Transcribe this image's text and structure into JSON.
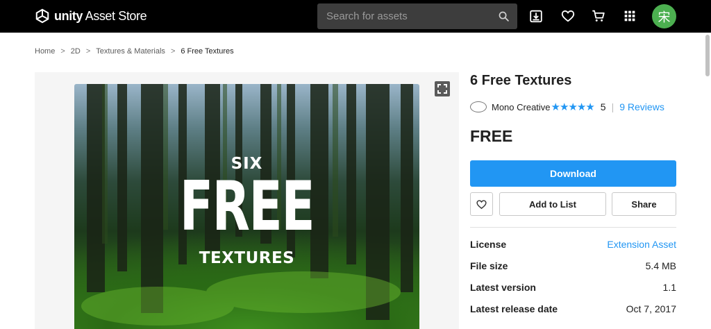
{
  "header": {
    "logo_text_bold": "unity",
    "logo_text_rest": " Asset Store",
    "search_placeholder": "Search for assets",
    "icons": [
      "download-icon",
      "heart-icon",
      "cart-icon",
      "apps-grid-icon"
    ],
    "avatar_initial": "宋",
    "avatar_color": "#4caf50"
  },
  "breadcrumb": {
    "items": [
      "Home",
      "2D",
      "Textures & Materials"
    ],
    "current": "6 Free Textures"
  },
  "gallery": {
    "hero_line1": "SIX",
    "hero_line2": "FREE",
    "hero_line3": "TEXTURES"
  },
  "product": {
    "title": "6 Free Textures",
    "publisher": "Mono Creative",
    "stars": "★★★★★",
    "rating": "5",
    "reviews": "9 Reviews",
    "price": "FREE",
    "download_label": "Download",
    "add_to_list_label": "Add to List",
    "share_label": "Share",
    "accent_color": "#2196f3"
  },
  "details": [
    {
      "key": "License",
      "value": "Extension Asset"
    },
    {
      "key": "File size",
      "value": "5.4 MB"
    },
    {
      "key": "Latest version",
      "value": "1.1"
    },
    {
      "key": "Latest release date",
      "value": "Oct 7, 2017"
    }
  ]
}
